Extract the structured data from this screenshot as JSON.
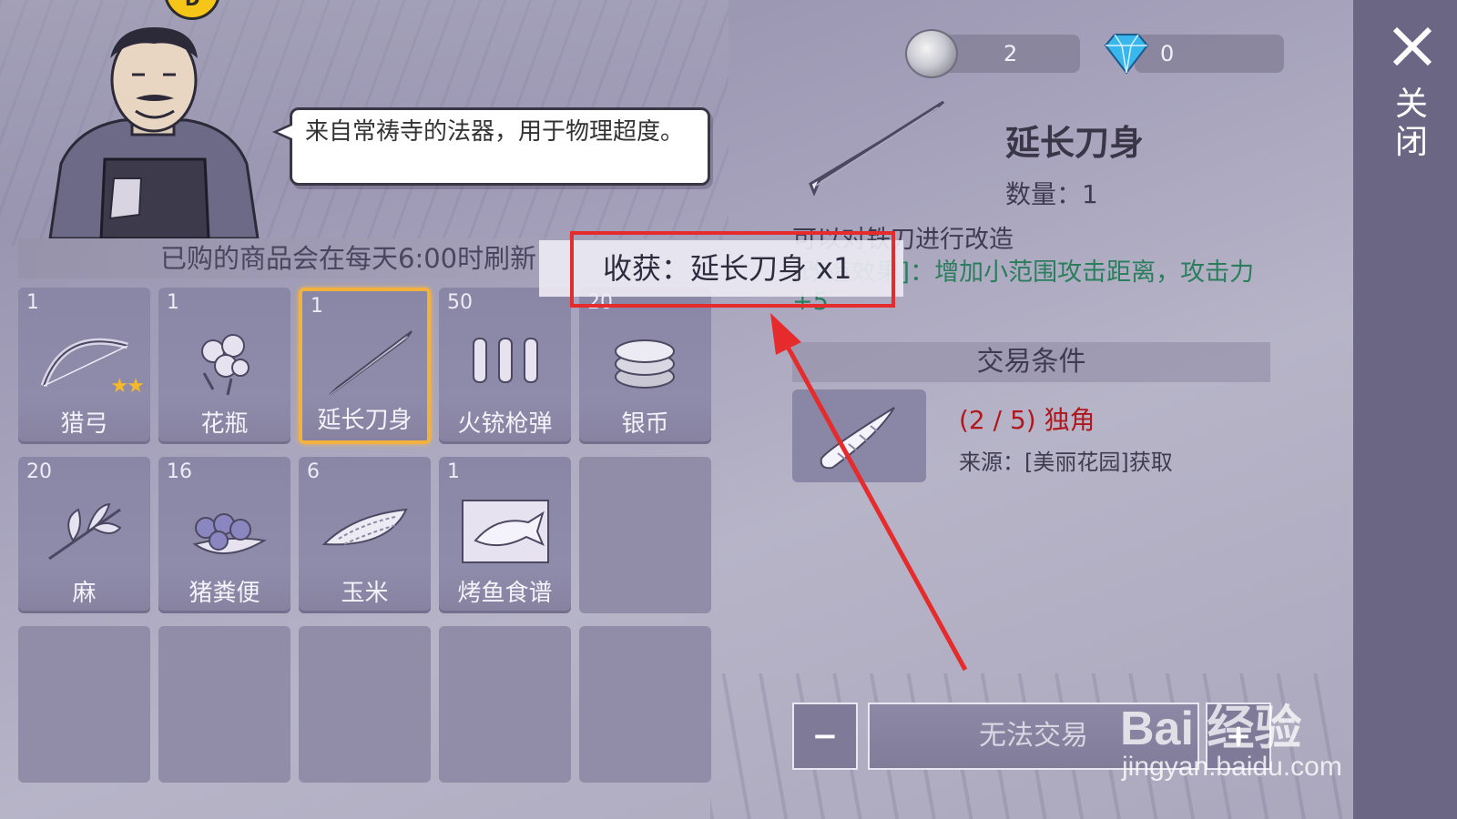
{
  "npc": {
    "dialogue": "来自常祷寺的法器，用于物理超度。"
  },
  "shop": {
    "refresh_notice": "已购的商品会在每天6:00时刷新",
    "items": [
      {
        "qty": "1",
        "name": "猎弓",
        "icon": "bow-icon",
        "stars": "★★"
      },
      {
        "qty": "1",
        "name": "花瓶",
        "icon": "flower-vase-icon"
      },
      {
        "qty": "1",
        "name": "延长刀身",
        "icon": "blade-icon",
        "selected": true
      },
      {
        "qty": "50",
        "name": "火铳枪弹",
        "icon": "bullets-icon"
      },
      {
        "qty": "20",
        "name": "银币",
        "icon": "silver-coin-icon"
      },
      {
        "qty": "20",
        "name": "麻",
        "icon": "hemp-icon"
      },
      {
        "qty": "16",
        "name": "猪粪便",
        "icon": "berries-icon"
      },
      {
        "qty": "6",
        "name": "玉米",
        "icon": "corn-icon"
      },
      {
        "qty": "1",
        "name": "烤鱼食谱",
        "icon": "fish-recipe-icon"
      }
    ]
  },
  "currency": {
    "coins": "2",
    "diamonds": "0"
  },
  "detail": {
    "title": "延长刀身",
    "quantity": "数量：1",
    "description": "可以对铁刀进行改造",
    "effect": "[改造效果]：增加小范围攻击距离，攻击力+5"
  },
  "trade": {
    "header": "交易条件",
    "requirement_count": "(2 / 5) 独角",
    "requirement_source": "来源：[美丽花园]获取",
    "minus": "−",
    "plus": "+",
    "action": "无法交易"
  },
  "close": {
    "label": "关闭"
  },
  "toast": {
    "text": "收获：延长刀身 x1"
  },
  "watermark": {
    "brand": "Bai 经验",
    "url": "jingyan.baidu.com"
  },
  "colors": {
    "highlight": "#e52b2b",
    "requirement": "#b0181e",
    "effect": "#2a7e5c",
    "selected_border": "#f2b23d"
  }
}
